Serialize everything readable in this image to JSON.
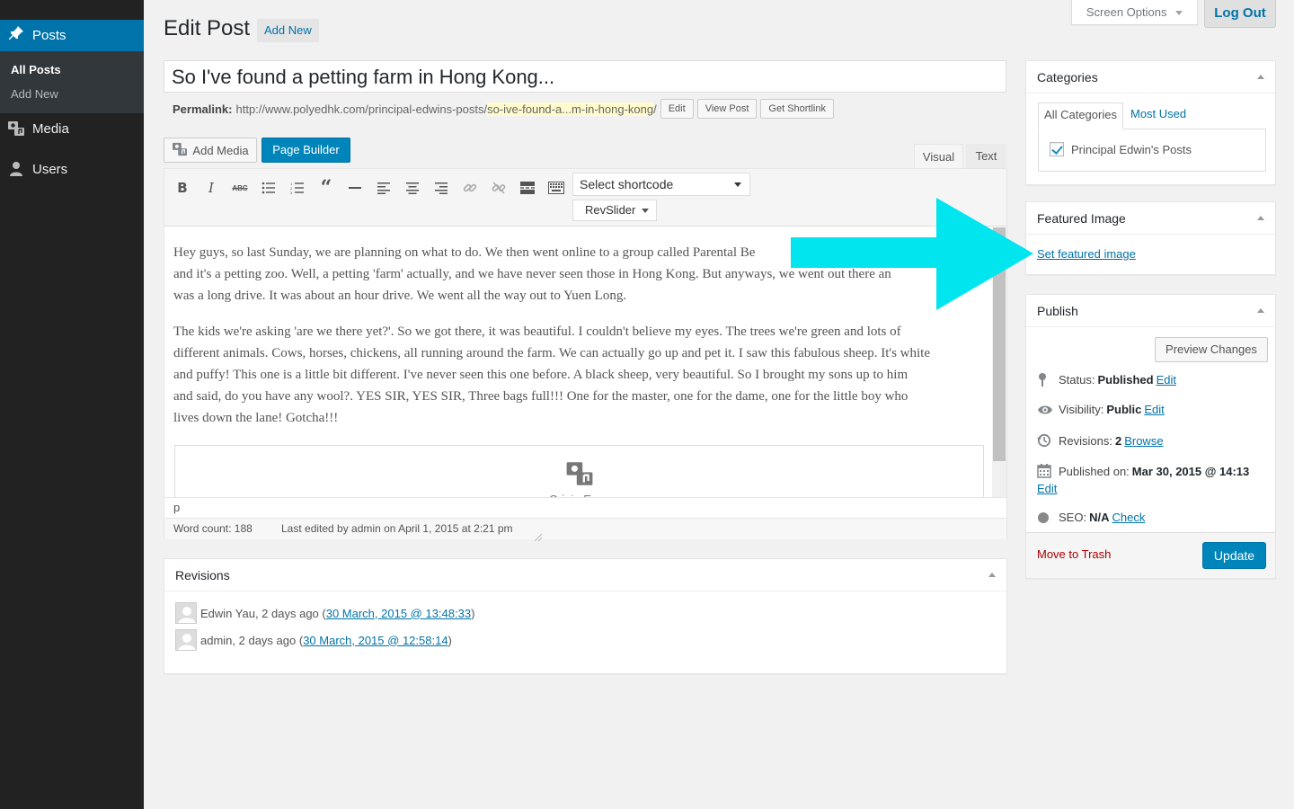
{
  "sidebar": {
    "posts_label": "Posts",
    "submenu": {
      "all_posts": "All Posts",
      "add_new": "Add New"
    },
    "media_label": "Media",
    "users_label": "Users"
  },
  "header": {
    "title": "Edit Post",
    "add_new": "Add New",
    "screen_options": "Screen Options",
    "log_out": "Log Out"
  },
  "post": {
    "title": "So I've found a petting farm in Hong Kong...",
    "permalink_label": "Permalink:",
    "permalink_base": "http://www.polyedhk.com/principal-edwins-posts/",
    "permalink_slug": "so-ive-found-a...m-in-hong-kong",
    "permalink_end": "/",
    "edit_btn": "Edit",
    "view_post_btn": "View Post",
    "shortlink_btn": "Get Shortlink"
  },
  "editor": {
    "add_media": "Add Media",
    "page_builder": "Page Builder",
    "tab_visual": "Visual",
    "tab_text": "Text",
    "shortcode_select": "Select shortcode",
    "revslider": "RevSlider",
    "paragraph1_lines": [
      "Hey guys, so last Sunday, we are planning on what to do. We then went online to a group called Parental Be",
      "and it's a petting zoo. Well, a petting 'farm' actually, and we have never seen those in Hong Kong. But anyways, we went out there an",
      "was a long drive. It was about an hour drive. We went all the way out to Yuen Long."
    ],
    "paragraph2_lines": [
      "The kids we're asking 'are we there yet?'. So we got there, it was beautiful. I couldn't believe my eyes. The trees we're green and lots of",
      "different animals. Cows, horses, chickens, all running around the farm. We can actually go up and pet it. I saw this fabulous sheep. It's white",
      "and puffy! This one is a little bit different. I've never seen this one before. A black sheep, very beautiful. So I brought my sons up to him",
      "and said, do you have any wool?. YES SIR, YES SIR, Three bags full!!! One for the master, one for the dame, one for the little boy who",
      "lives down the lane! Gotcha!!!"
    ],
    "embed_text": "Origin Error",
    "path": "p",
    "word_count": "Word count: 188",
    "last_edited": "Last edited by admin on April 1, 2015 at 2:21 pm"
  },
  "revisions": {
    "title": "Revisions",
    "items": [
      {
        "author": "Edwin Yau, 2 days ago (",
        "link": "30 March, 2015 @ 13:48:33",
        "close": ")"
      },
      {
        "author": "admin, 2 days ago (",
        "link": "30 March, 2015 @ 12:58:14",
        "close": ")"
      }
    ]
  },
  "categories": {
    "title": "Categories",
    "tab_all": "All Categories",
    "tab_most_used": "Most Used",
    "items": [
      {
        "label": "Principal Edwin's Posts",
        "checked": true
      }
    ]
  },
  "featured_image": {
    "title": "Featured Image",
    "link": "Set featured image"
  },
  "publish": {
    "title": "Publish",
    "preview": "Preview Changes",
    "status_label": "Status:",
    "status_value": "Published",
    "visibility_label": "Visibility:",
    "visibility_value": "Public",
    "revisions_label": "Revisions:",
    "revisions_value": "2",
    "browse": "Browse",
    "published_label": "Published on:",
    "published_value": "Mar 30, 2015 @ 14:13",
    "seo_label": "SEO:",
    "seo_value": "N/A",
    "check": "Check",
    "edit": "Edit",
    "trash": "Move to Trash",
    "update": "Update"
  },
  "colors": {
    "accent": "#0073aa",
    "button_primary": "#0085ba",
    "sidebar_bg": "#222222",
    "annotation_arrow": "#00e5ee"
  }
}
